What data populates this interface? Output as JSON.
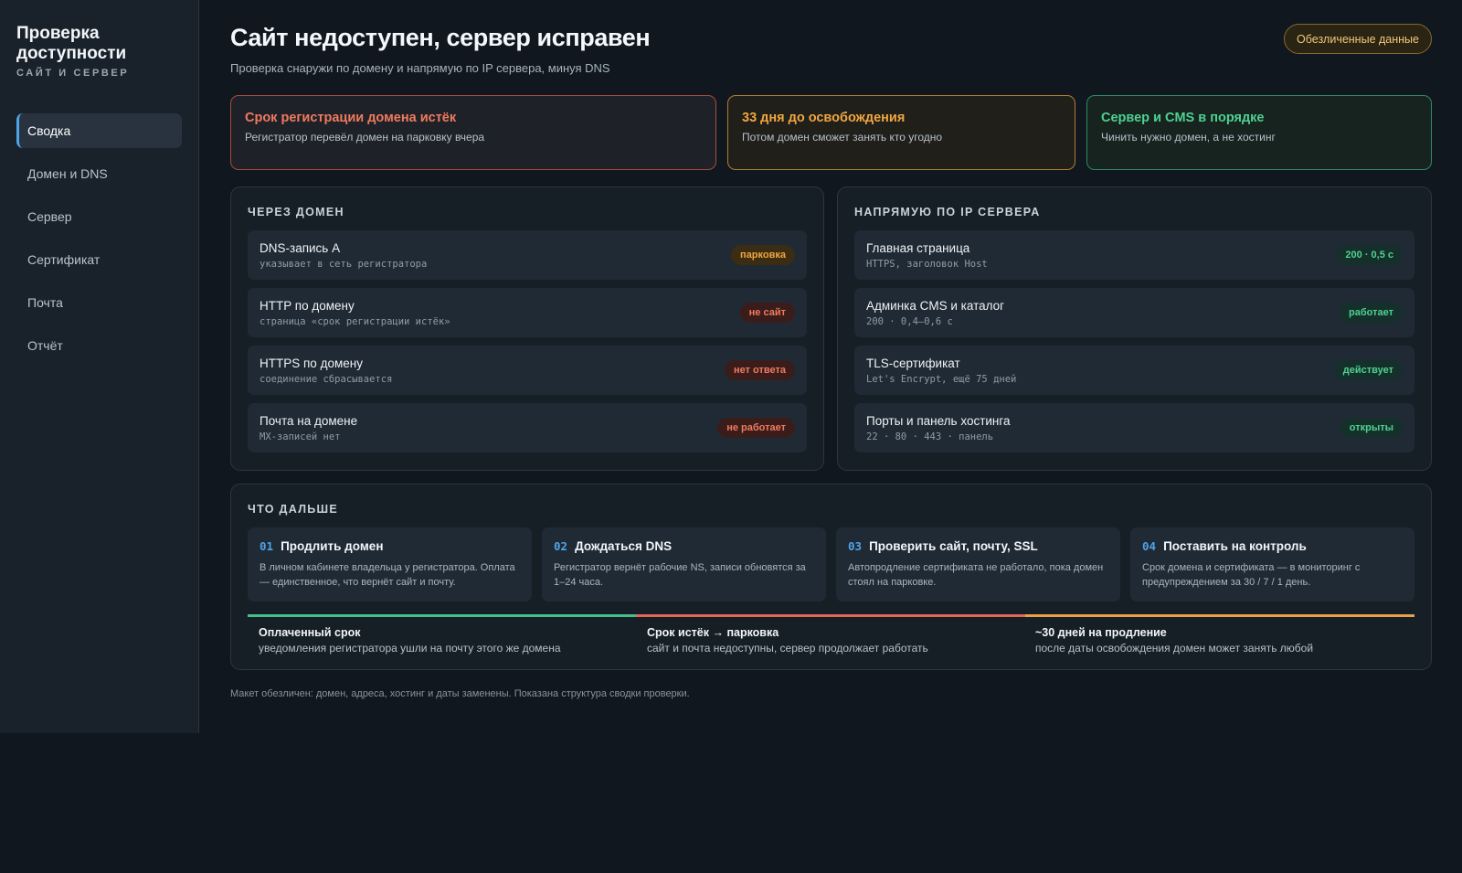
{
  "sidebar": {
    "brand_title_line1": "Проверка",
    "brand_title_line2": "доступности",
    "brand_sub": "САЙТ И СЕРВЕР",
    "items": [
      {
        "label": "Сводка",
        "active": true
      },
      {
        "label": "Домен и DNS"
      },
      {
        "label": "Сервер"
      },
      {
        "label": "Сертификат"
      },
      {
        "label": "Почта"
      },
      {
        "label": "Отчёт"
      }
    ]
  },
  "header": {
    "title": "Сайт недоступен, сервер исправен",
    "subtitle": "Проверка снаружи по домену и напрямую по IP сервера, минуя DNS",
    "badge": "Обезличенные данные"
  },
  "alerts": [
    {
      "title": "Срок регистрации домена истёк",
      "text": "Регистратор перевёл домен на парковку вчера",
      "color": "#f07a5e"
    },
    {
      "title": "33 дня до освобождения",
      "text": "Потом домен сможет занять кто угодно",
      "color": "#f0a640"
    },
    {
      "title": "Сервер и CMS в порядке",
      "text": "Чинить нужно домен, а не хостинг",
      "color": "#4fd191"
    }
  ],
  "domain_panel": {
    "title": "ЧЕРЕЗ ДОМЕН",
    "rows": [
      {
        "name": "DNS-запись A",
        "detail": "указывает в сеть регистратора",
        "status": "парковка"
      },
      {
        "name": "HTTP по домену",
        "detail": "страница «срок регистрации истёк»",
        "status": "не сайт"
      },
      {
        "name": "HTTPS по домену",
        "detail": "соединение сбрасывается",
        "status": "нет ответа"
      },
      {
        "name": "Почта на домене",
        "detail": "MX-записей нет",
        "status": "не работает"
      }
    ]
  },
  "ip_panel": {
    "title": "НАПРЯМУЮ ПО IP СЕРВЕРА",
    "rows": [
      {
        "name": "Главная страница",
        "detail": "HTTPS, заголовок Host",
        "status": "200 · 0,5 с"
      },
      {
        "name": "Админка CMS и каталог",
        "detail": "200 · 0,4–0,6 с",
        "status": "работает"
      },
      {
        "name": "TLS-сертификат",
        "detail": "Let's Encrypt, ещё 75 дней",
        "status": "действует"
      },
      {
        "name": "Порты и панель хостинга",
        "detail": "22 · 80 · 443 · панель",
        "status": "открыты"
      }
    ]
  },
  "next_panel": {
    "title": "ЧТО ДАЛЬШЕ",
    "steps": [
      {
        "num": "01",
        "title": "Продлить домен",
        "text": "В личном кабинете владельца у регистратора. Оплата — единственное, что вернёт сайт и почту."
      },
      {
        "num": "02",
        "title": "Дождаться DNS",
        "text": "Регистратор вернёт рабочие NS, записи обновятся за 1–24 часа."
      },
      {
        "num": "03",
        "title": "Проверить сайт, почту, SSL",
        "text": "Автопродление сертификата не работало, пока домен стоял на парковке."
      },
      {
        "num": "04",
        "title": "Поставить на контроль",
        "text": "Срок домена и сертификата — в мониторинг с предупреждением за 30 / 7 / 1 день."
      }
    ],
    "timeline": [
      {
        "title": "Оплаченный срок",
        "text": "уведомления регистратора ушли на почту этого же домена",
        "color": "#45c08a"
      },
      {
        "title": "Срок истёк → парковка",
        "text": "сайт и почта недоступны, сервер продолжает работать",
        "color": "#e2675a"
      },
      {
        "title": "~30 дней на продление",
        "text": "после даты освобождения домен может занять любой",
        "color": "#e9a247"
      }
    ]
  },
  "footnote": "Макет обезличен: домен, адреса, хостинг и даты заменены. Показана структура сводки проверки."
}
